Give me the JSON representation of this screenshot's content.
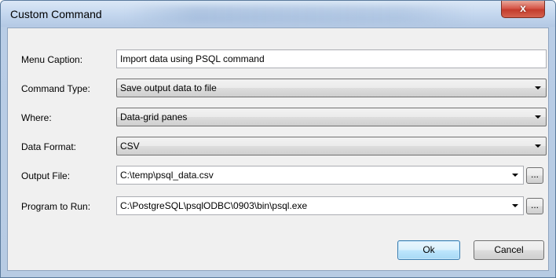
{
  "window": {
    "title": "Custom Command",
    "close_label": "x"
  },
  "form": {
    "menu_caption": {
      "label": "Menu Caption:",
      "value": "Import data using PSQL command"
    },
    "command_type": {
      "label": "Command Type:",
      "value": "Save output data to file"
    },
    "where": {
      "label": "Where:",
      "value": "Data-grid panes"
    },
    "data_format": {
      "label": "Data Format:",
      "value": "CSV"
    },
    "output_file": {
      "label": "Output File:",
      "value": "C:\\temp\\psql_data.csv",
      "browse_label": "..."
    },
    "program_to_run": {
      "label": "Program to Run:",
      "value": "C:\\PostgreSQL\\psqlODBC\\0903\\bin\\psql.exe",
      "browse_label": "..."
    }
  },
  "buttons": {
    "ok": "Ok",
    "cancel": "Cancel"
  },
  "icons": {
    "dropdown": "chevron-down-icon",
    "close": "close-icon"
  }
}
